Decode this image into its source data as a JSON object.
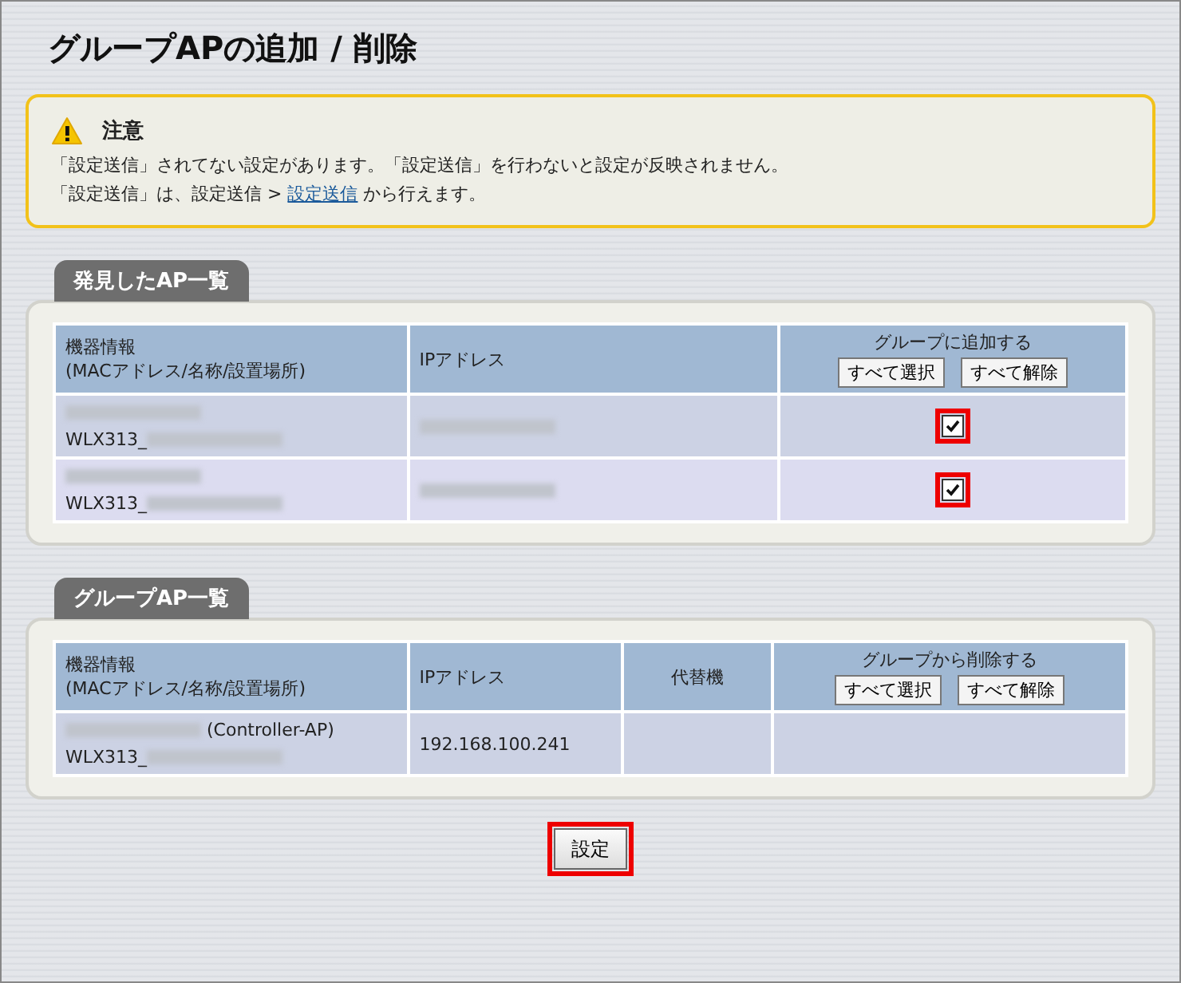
{
  "title": "グループAPの追加 / 削除",
  "notice": {
    "heading": "注意",
    "line1": "「設定送信」されてない設定があります。「設定送信」を行わないと設定が反映されません。",
    "line2_before": "「設定送信」は、設定送信 > ",
    "link": "設定送信",
    "line2_after": " から行えます。"
  },
  "sections": [
    {
      "tab": "発見したAP一覧",
      "columns": [
        {
          "kind": "text",
          "label": "機器情報\n(MACアドレス/名称/設置場所)"
        },
        {
          "kind": "text",
          "label": "IPアドレス"
        },
        {
          "kind": "action",
          "label": "グループに追加する",
          "buttons": [
            "すべて選択",
            "すべて解除"
          ]
        }
      ],
      "rows": [
        {
          "cells": [
            [
              [
                {
                  "kind": "blur"
                }
              ],
              [
                {
                  "kind": "text",
                  "text": "WLX313_"
                },
                {
                  "kind": "blur"
                }
              ]
            ],
            [
              [
                {
                  "kind": "blur"
                }
              ]
            ],
            {
              "kind": "checkbox",
              "checked": true,
              "highlighted": true
            }
          ]
        },
        {
          "cells": [
            [
              [
                {
                  "kind": "blur"
                }
              ],
              [
                {
                  "kind": "text",
                  "text": "WLX313_"
                },
                {
                  "kind": "blur"
                }
              ]
            ],
            [
              [
                {
                  "kind": "blur"
                }
              ]
            ],
            {
              "kind": "checkbox",
              "checked": true,
              "highlighted": true
            }
          ]
        }
      ]
    },
    {
      "tab": "グループAP一覧",
      "columns": [
        {
          "kind": "text",
          "label": "機器情報\n(MACアドレス/名称/設置場所)"
        },
        {
          "kind": "text",
          "label": "IPアドレス"
        },
        {
          "kind": "center",
          "label": "代替機"
        },
        {
          "kind": "action",
          "label": "グループから削除する",
          "buttons": [
            "すべて選択",
            "すべて解除"
          ]
        }
      ],
      "rows": [
        {
          "cells": [
            [
              [
                {
                  "kind": "blur"
                },
                {
                  "kind": "text",
                  "text": " (Controller-AP)"
                }
              ],
              [
                {
                  "kind": "text",
                  "text": "WLX313_"
                },
                {
                  "kind": "blur"
                }
              ]
            ],
            [
              [
                {
                  "kind": "text",
                  "text": "192.168.100.241"
                }
              ]
            ],
            {
              "kind": "empty"
            },
            {
              "kind": "empty"
            }
          ]
        }
      ]
    }
  ],
  "submit": {
    "label": "設定",
    "highlighted": true
  }
}
